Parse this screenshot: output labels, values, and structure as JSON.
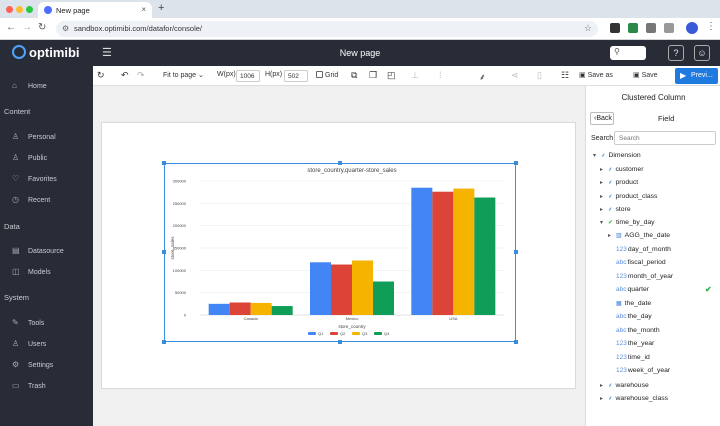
{
  "browser": {
    "tab_title": "New page",
    "tab_close": "×",
    "new_tab": "+",
    "url": "sandbox.optimibi.com/datafor/console/"
  },
  "header": {
    "logo": "optimibi",
    "page_title": "New page",
    "search_icon": "search-icon",
    "help": "?",
    "user_icon": "user-icon"
  },
  "sidebar": {
    "sections": [
      {
        "label": "Content"
      },
      {
        "label": "Data"
      },
      {
        "label": "System"
      }
    ],
    "items": [
      {
        "label": "Home",
        "icon": "home-icon"
      },
      {
        "label": "Personal",
        "icon": "user-icon"
      },
      {
        "label": "Public",
        "icon": "users-icon"
      },
      {
        "label": "Favorites",
        "icon": "heart-icon"
      },
      {
        "label": "Recent",
        "icon": "clock-icon"
      },
      {
        "label": "Datasource",
        "icon": "database-icon"
      },
      {
        "label": "Models",
        "icon": "cube-icon"
      },
      {
        "label": "Tools",
        "icon": "wrench-icon"
      },
      {
        "label": "Users",
        "icon": "users-icon"
      },
      {
        "label": "Settings",
        "icon": "gear-icon"
      },
      {
        "label": "Trash",
        "icon": "trash-icon"
      }
    ]
  },
  "toolbar": {
    "fit_label": "Fit to page",
    "width_label": "W(px)",
    "width_value": "1006",
    "height_label": "H(px)",
    "height_value": "502",
    "grid_label": "Grid",
    "save_as": "Save as",
    "save": "Save",
    "preview": "Previ..."
  },
  "panel": {
    "title": "Clustered Column",
    "back": "Back",
    "field": "Field",
    "search_label": "Search",
    "search_placeholder": "Search",
    "tree": [
      {
        "label": "Dimension",
        "level": 0,
        "toggle": "▾",
        "icon": "hierarchy-icon"
      },
      {
        "label": "customer",
        "level": 1,
        "toggle": "▸",
        "icon": "hierarchy-icon"
      },
      {
        "label": "product",
        "level": 1,
        "toggle": "▸",
        "icon": "hierarchy-icon"
      },
      {
        "label": "product_class",
        "level": 1,
        "toggle": "▸",
        "icon": "hierarchy-icon"
      },
      {
        "label": "store",
        "level": 1,
        "toggle": "▸",
        "icon": "hierarchy-icon"
      },
      {
        "label": "time_by_day",
        "level": 1,
        "toggle": "▾",
        "icon": "hierarchy-icon",
        "checked": true
      },
      {
        "label": "AGG_the_date",
        "level": 2,
        "toggle": "▸",
        "icon": "bar-icon"
      },
      {
        "label": "day_of_month",
        "level": 2,
        "type": "123"
      },
      {
        "label": "fiscal_period",
        "level": 2,
        "type": "abc"
      },
      {
        "label": "month_of_year",
        "level": 2,
        "type": "123"
      },
      {
        "label": "quarter",
        "level": 2,
        "type": "abc",
        "used": true
      },
      {
        "label": "the_date",
        "level": 2,
        "icon": "calendar-icon"
      },
      {
        "label": "the_day",
        "level": 2,
        "type": "abc"
      },
      {
        "label": "the_month",
        "level": 2,
        "type": "abc"
      },
      {
        "label": "the_year",
        "level": 2,
        "type": "123"
      },
      {
        "label": "time_id",
        "level": 2,
        "type": "123"
      },
      {
        "label": "week_of_year",
        "level": 2,
        "type": "123"
      },
      {
        "label": "warehouse",
        "level": 1,
        "toggle": "▸",
        "icon": "hierarchy-icon"
      },
      {
        "label": "warehouse_class",
        "level": 1,
        "toggle": "▸",
        "icon": "hierarchy-icon"
      }
    ]
  },
  "chart_data": {
    "type": "bar",
    "title": "store_country,quarter-store_sales",
    "xlabel": "store_country",
    "ylabel": "store_sales",
    "categories": [
      "Canada",
      "Mexico",
      "USA"
    ],
    "ylim": [
      0,
      300000
    ],
    "yticks": [
      0,
      50000,
      100000,
      150000,
      200000,
      250000,
      300000
    ],
    "grid": true,
    "legend": "bottom",
    "series": [
      {
        "name": "Q1",
        "color": "#4285f4",
        "values": [
          25000,
          118000,
          285000
        ]
      },
      {
        "name": "Q2",
        "color": "#db4437",
        "values": [
          28000,
          113000,
          276000
        ]
      },
      {
        "name": "Q3",
        "color": "#f4b400",
        "values": [
          27000,
          122000,
          283000
        ]
      },
      {
        "name": "Q4",
        "color": "#0f9d58",
        "values": [
          20000,
          75000,
          263000
        ]
      }
    ]
  }
}
